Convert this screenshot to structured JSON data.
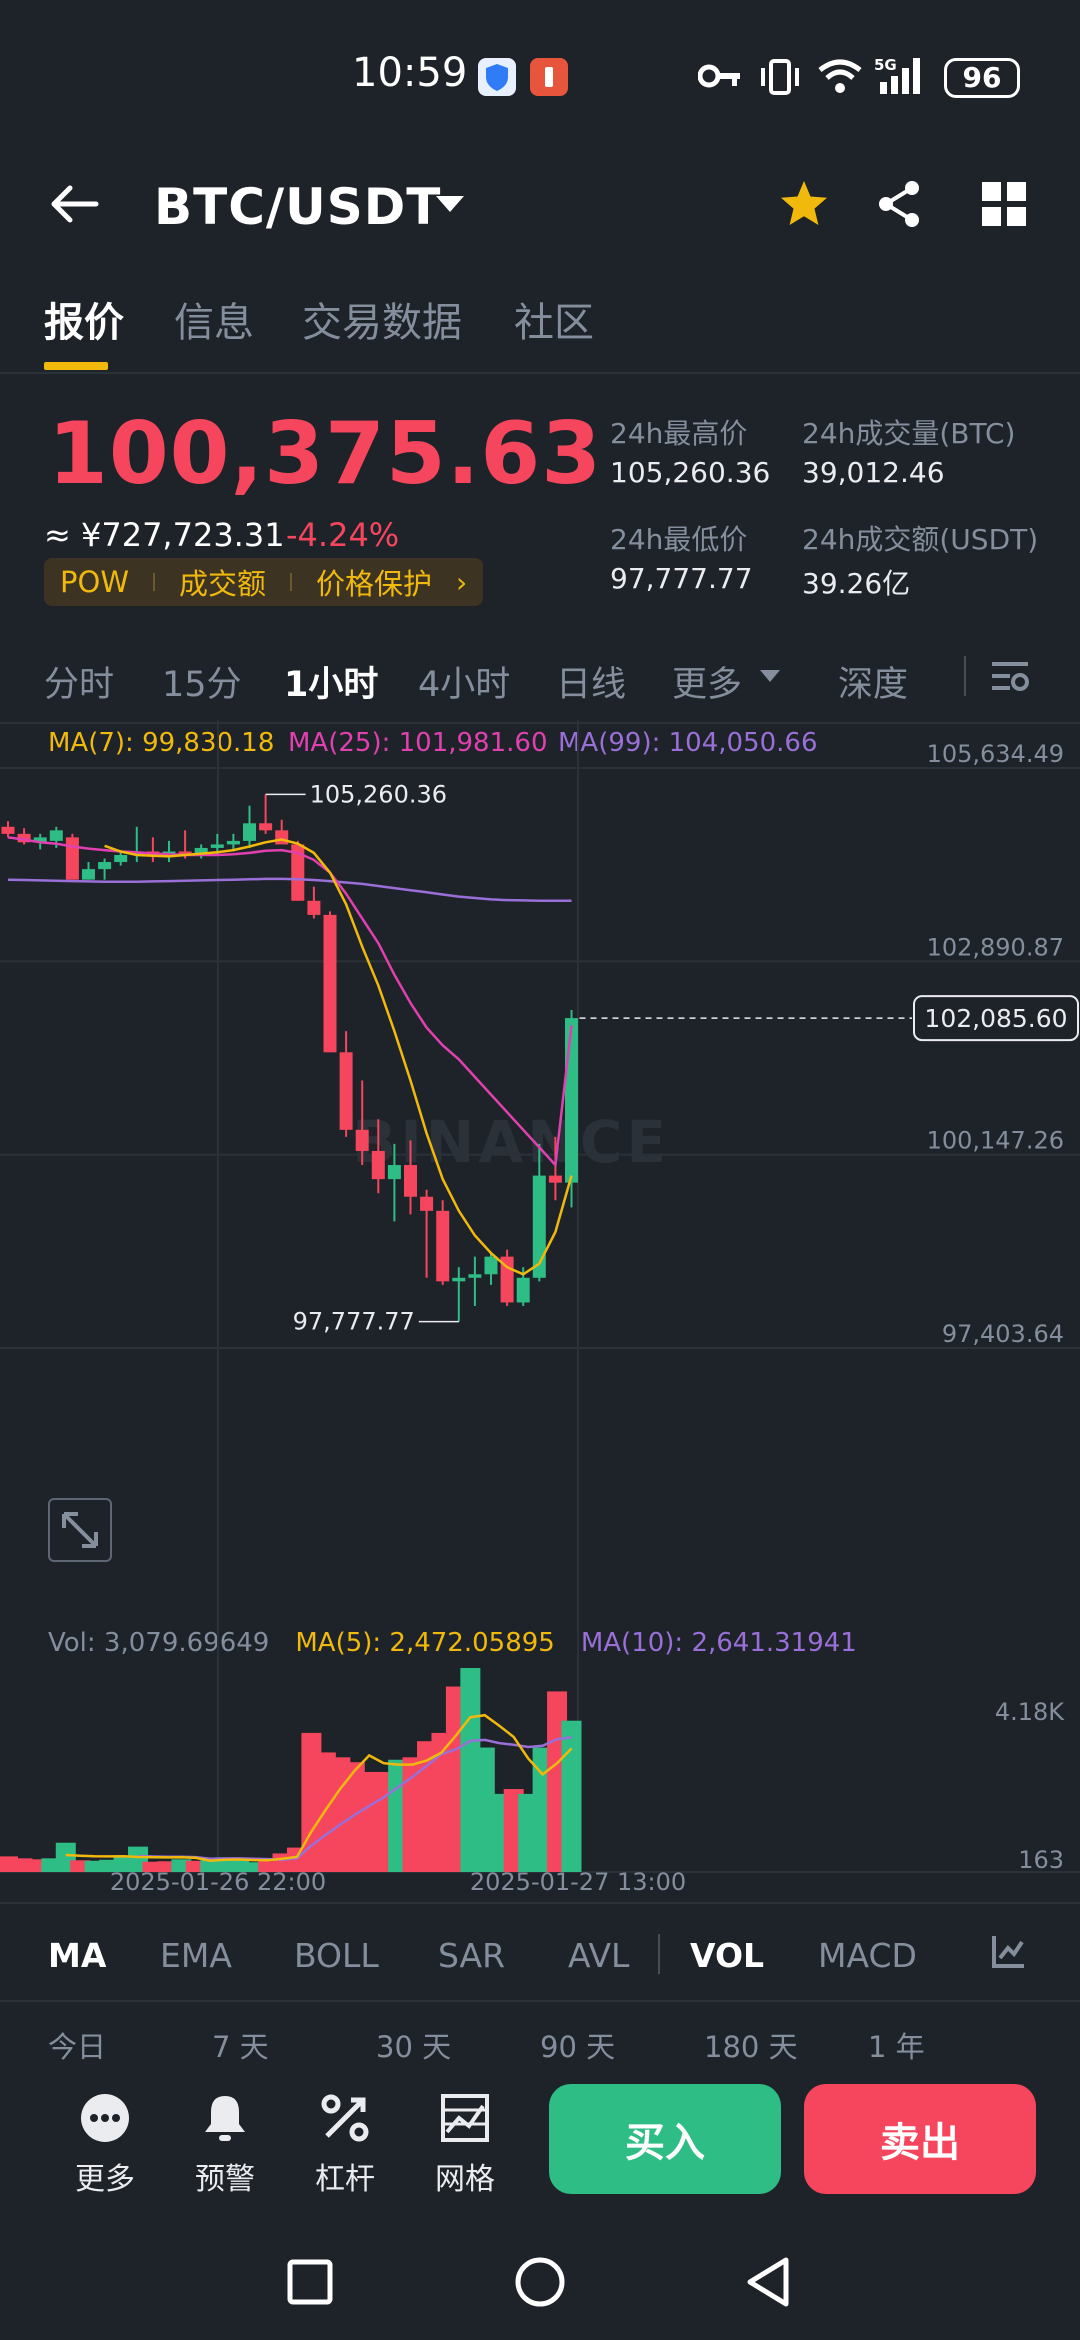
{
  "status_bar": {
    "time": "10:59",
    "battery": "96",
    "network": "5G"
  },
  "header": {
    "pair": "BTC/USDT",
    "back_icon": "arrow-left-icon",
    "favorite_icon": "star-icon",
    "share_icon": "share-icon",
    "grid_icon": "grid-icon"
  },
  "tabs": [
    "报价",
    "信息",
    "交易数据",
    "社区"
  ],
  "ticker": {
    "last_price": "100,375.63",
    "cny_price": "≈ ¥727,723.31",
    "change_pct": "-4.24%",
    "tags": [
      "POW",
      "成交额",
      "价格保护"
    ],
    "high_label": "24h最高价",
    "high_value": "105,260.36",
    "vol_btc_label": "24h成交量(BTC)",
    "vol_btc_value": "39,012.46",
    "low_label": "24h最低价",
    "low_value": "97,777.77",
    "vol_usdt_label": "24h成交额(USDT)",
    "vol_usdt_value": "39.26亿"
  },
  "intervals": [
    "分时",
    "15分",
    "1小时",
    "4小时",
    "日线",
    "更多",
    "深度"
  ],
  "ma_legend": {
    "ma7": "MA(7): 99,830.18",
    "ma25": "MA(25): 101,981.60",
    "ma99": "MA(99): 104,050.66"
  },
  "watermark": "BINANCE",
  "chart_data": {
    "type": "candlestick",
    "ylim": [
      97403.64,
      105634.49
    ],
    "y_ticks": [
      "105,634.49",
      "102,890.87",
      "100,147.26",
      "97,403.64"
    ],
    "current_price_label": "102,085.60",
    "high_marker": "105,260.36",
    "low_marker": "97,777.77",
    "x_labels": [
      "2025-01-26 22:00",
      "2025-01-27 13:00"
    ],
    "colors": {
      "up": "#2ebd85",
      "down": "#f6465d",
      "ma7": "#f0b90b",
      "ma25": "#e040b0",
      "ma99": "#9a6fd8"
    },
    "candles": [
      {
        "o": 104800,
        "h": 104880,
        "l": 104650,
        "c": 104700
      },
      {
        "o": 104700,
        "h": 104780,
        "l": 104550,
        "c": 104580
      },
      {
        "o": 104580,
        "h": 104700,
        "l": 104480,
        "c": 104650
      },
      {
        "o": 104600,
        "h": 104800,
        "l": 104500,
        "c": 104750
      },
      {
        "o": 104650,
        "h": 104700,
        "l": 104200,
        "c": 104050
      },
      {
        "o": 104050,
        "h": 104300,
        "l": 104050,
        "c": 104200
      },
      {
        "o": 104200,
        "h": 104350,
        "l": 104050,
        "c": 104300
      },
      {
        "o": 104300,
        "h": 104450,
        "l": 104250,
        "c": 104400
      },
      {
        "o": 104400,
        "h": 104800,
        "l": 104300,
        "c": 104450
      },
      {
        "o": 104450,
        "h": 104650,
        "l": 104300,
        "c": 104400
      },
      {
        "o": 104400,
        "h": 104600,
        "l": 104300,
        "c": 104450
      },
      {
        "o": 104450,
        "h": 104750,
        "l": 104350,
        "c": 104400
      },
      {
        "o": 104400,
        "h": 104550,
        "l": 104350,
        "c": 104500
      },
      {
        "o": 104500,
        "h": 104700,
        "l": 104400,
        "c": 104550
      },
      {
        "o": 104550,
        "h": 104700,
        "l": 104450,
        "c": 104600
      },
      {
        "o": 104600,
        "h": 105100,
        "l": 104500,
        "c": 104850
      },
      {
        "o": 104850,
        "h": 105260.36,
        "l": 104700,
        "c": 104750
      },
      {
        "o": 104750,
        "h": 104900,
        "l": 104650,
        "c": 104550
      },
      {
        "o": 104550,
        "h": 104600,
        "l": 103750,
        "c": 103750
      },
      {
        "o": 103750,
        "h": 103950,
        "l": 103500,
        "c": 103550
      },
      {
        "o": 103550,
        "h": 103600,
        "l": 101600,
        "c": 101600
      },
      {
        "o": 101600,
        "h": 101900,
        "l": 100400,
        "c": 100500
      },
      {
        "o": 100500,
        "h": 101200,
        "l": 100000,
        "c": 100200
      },
      {
        "o": 100200,
        "h": 100650,
        "l": 99600,
        "c": 99800
      },
      {
        "o": 99800,
        "h": 100300,
        "l": 99200,
        "c": 100000
      },
      {
        "o": 100000,
        "h": 100350,
        "l": 99300,
        "c": 99550
      },
      {
        "o": 99550,
        "h": 99650,
        "l": 98400,
        "c": 99350
      },
      {
        "o": 99350,
        "h": 99500,
        "l": 98300,
        "c": 98350
      },
      {
        "o": 98350,
        "h": 98550,
        "l": 97777.77,
        "c": 98400
      },
      {
        "o": 98400,
        "h": 98700,
        "l": 98000,
        "c": 98450
      },
      {
        "o": 98450,
        "h": 98750,
        "l": 98300,
        "c": 98700
      },
      {
        "o": 98700,
        "h": 98800,
        "l": 98000,
        "c": 98050
      },
      {
        "o": 98050,
        "h": 98550,
        "l": 98000,
        "c": 98400
      },
      {
        "o": 98400,
        "h": 100300,
        "l": 98350,
        "c": 99850
      },
      {
        "o": 99850,
        "h": 100400,
        "l": 99500,
        "c": 99750
      },
      {
        "o": 99750,
        "h": 102200,
        "l": 99400,
        "c": 102085.6
      }
    ],
    "ma7": [
      null,
      null,
      null,
      null,
      null,
      null,
      104530,
      104450,
      104400,
      104390,
      104380,
      104400,
      104420,
      104440,
      104470,
      104520,
      104580,
      104620,
      104560,
      104430,
      104150,
      103700,
      103100,
      102550,
      101900,
      101200,
      100450,
      99800,
      99350,
      99000,
      98750,
      98550,
      98450,
      98600,
      99050,
      99850
    ],
    "ma25": [
      104650,
      104620,
      104580,
      104560,
      104520,
      104490,
      104470,
      104450,
      104440,
      104420,
      104410,
      104400,
      104400,
      104400,
      104410,
      104430,
      104460,
      104470,
      104430,
      104330,
      104150,
      103850,
      103500,
      103150,
      102700,
      102300,
      101950,
      101700,
      101500,
      101250,
      101000,
      100750,
      100500,
      100250,
      100000,
      101981.6
    ],
    "ma99": [
      104050,
      104045,
      104040,
      104035,
      104030,
      104025,
      104020,
      104020,
      104020,
      104025,
      104030,
      104035,
      104040,
      104045,
      104050,
      104055,
      104060,
      104060,
      104055,
      104045,
      104030,
      104010,
      103990,
      103960,
      103930,
      103900,
      103870,
      103840,
      103810,
      103790,
      103770,
      103760,
      103755,
      103752,
      103750,
      103750
    ],
    "volume": {
      "legend_vol": "Vol: 3,079.69649",
      "legend_ma5": "MA(5): 2,472.05895",
      "legend_ma10": "MA(10): 2,641.31941",
      "y_ticks": [
        "4.18K",
        "163"
      ],
      "ylim": [
        0,
        4180
      ],
      "values": [
        320,
        280,
        260,
        280,
        600,
        240,
        230,
        250,
        300,
        520,
        210,
        220,
        260,
        230,
        240,
        300,
        250,
        200,
        220,
        380,
        500,
        2850,
        2450,
        2350,
        2250,
        2050,
        2050,
        2300,
        2350,
        2680,
        2850,
        3800,
        4180,
        2550,
        1600,
        1700,
        1600,
        2550,
        3700,
        3100
      ]
    }
  },
  "indicators": [
    "MA",
    "EMA",
    "BOLL",
    "SAR",
    "AVL",
    "VOL",
    "MACD"
  ],
  "ranges": [
    "今日",
    "7 天",
    "30 天",
    "90 天",
    "180 天",
    "1 年"
  ],
  "actions": [
    {
      "label": "更多",
      "icon": "more-icon"
    },
    {
      "label": "预警",
      "icon": "bell-icon"
    },
    {
      "label": "杠杆",
      "icon": "leverage-icon"
    },
    {
      "label": "网格",
      "icon": "grid-bot-icon"
    }
  ],
  "buy_label": "买入",
  "sell_label": "卖出"
}
